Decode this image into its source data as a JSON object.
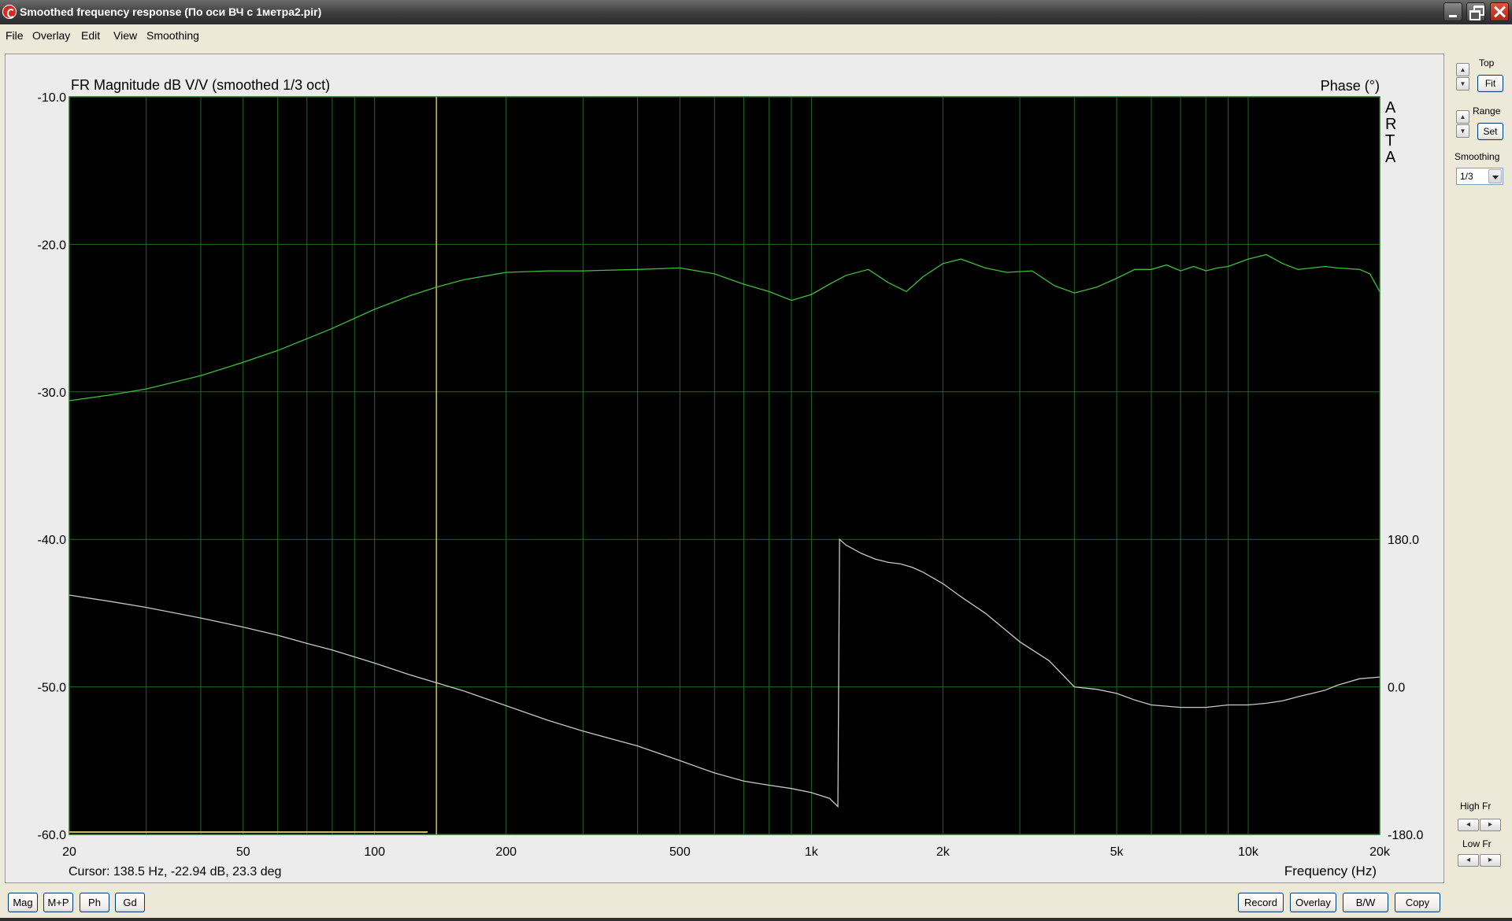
{
  "window": {
    "title": "Smoothed frequency response (По оси ВЧ с 1метра2.pir)"
  },
  "menu": [
    "File",
    "Overlay",
    "Edit",
    "View",
    "Smoothing"
  ],
  "sidebar": {
    "top_label": "Top",
    "fit_button": "Fit",
    "range_label": "Range",
    "set_button": "Set",
    "smoothing_label": "Smoothing",
    "smoothing_value": "1/3",
    "high_fr_label": "High Fr",
    "low_fr_label": "Low Fr"
  },
  "bottom_buttons": {
    "mag": "Mag",
    "mp": "M+P",
    "ph": "Ph",
    "gd": "Gd",
    "record": "Record",
    "overlay": "Overlay",
    "bw": "B/W",
    "copy": "Copy"
  },
  "plot": {
    "background": "#000000",
    "grid_color": "#1f6b1f",
    "magnitude_color": "#3cbf3c",
    "phase_color": "#c8c8c8",
    "cursor_color": "#c8c060"
  },
  "chart_data": {
    "type": "line",
    "title": "FR Magnitude dB V/V (smoothed 1/3 oct)",
    "right_title": "Phase (°)",
    "watermark": "ARTA",
    "xlabel": "Frequency (Hz)",
    "x_scale": "log",
    "xlim": [
      20,
      20000
    ],
    "ylim": [
      -60,
      -10
    ],
    "y2lim": [
      -180,
      180
    ],
    "x_ticks": [
      20,
      50,
      100,
      200,
      500,
      1000,
      2000,
      5000,
      10000,
      20000
    ],
    "x_tick_labels": [
      "20",
      "50",
      "100",
      "200",
      "500",
      "1k",
      "2k",
      "5k",
      "10k",
      "20k"
    ],
    "y_ticks": [
      -10,
      -20,
      -30,
      -40,
      -50,
      -60
    ],
    "y_tick_labels": [
      "-10.0",
      "-20.0",
      "-30.0",
      "-40.0",
      "-50.0",
      "-60.0"
    ],
    "y2_ticks": [
      180,
      0,
      -180
    ],
    "y2_tick_labels": [
      "180.0",
      "0.0",
      "-180.0"
    ],
    "grid": true,
    "cursor": {
      "freq": 138.5,
      "text": "Cursor: 138.5 Hz, -22.94 dB, 23.3 deg"
    },
    "series": [
      {
        "axis": "left",
        "x": [
          20,
          25,
          30,
          40,
          50,
          60,
          70,
          80,
          100,
          120,
          138.5,
          160,
          200,
          250,
          300,
          400,
          500,
          600,
          700,
          800,
          900,
          1000,
          1100,
          1200,
          1350,
          1500,
          1650,
          1800,
          2000,
          2200,
          2500,
          2800,
          3200,
          3600,
          4000,
          4500,
          5000,
          5500,
          6000,
          6500,
          7000,
          7500,
          8000,
          8500,
          9000,
          10000,
          11000,
          12000,
          13000,
          14000,
          15000,
          16000,
          18000,
          19000,
          20000
        ],
        "values": [
          -30.6,
          -30.2,
          -29.8,
          -28.9,
          -28.0,
          -27.2,
          -26.4,
          -25.7,
          -24.4,
          -23.5,
          -22.9,
          -22.4,
          -21.9,
          -21.8,
          -21.8,
          -21.7,
          -21.6,
          -22.0,
          -22.7,
          -23.2,
          -23.8,
          -23.4,
          -22.7,
          -22.1,
          -21.7,
          -22.6,
          -23.2,
          -22.2,
          -21.3,
          -21.0,
          -21.6,
          -21.9,
          -21.8,
          -22.8,
          -23.3,
          -22.9,
          -22.3,
          -21.7,
          -21.7,
          -21.4,
          -21.8,
          -21.5,
          -21.8,
          -21.6,
          -21.5,
          -21.0,
          -20.7,
          -21.3,
          -21.7,
          -21.6,
          -21.5,
          -21.6,
          -21.7,
          -22.0,
          -23.2
        ]
      },
      {
        "axis": "right",
        "x": [
          20,
          25,
          30,
          40,
          50,
          60,
          70,
          80,
          100,
          120,
          138.5,
          160,
          200,
          250,
          300,
          400,
          500,
          600,
          700,
          800,
          900,
          1000,
          1100,
          1150,
          1160,
          1200,
          1300,
          1400,
          1500,
          1600,
          1700,
          1800,
          2000,
          2200,
          2500,
          3000,
          3500,
          4000,
          4500,
          5000,
          5500,
          6000,
          7000,
          8000,
          9000,
          10000,
          11000,
          12000,
          13000,
          14000,
          15000,
          16000,
          18000,
          20000
        ],
        "values": [
          112,
          104,
          97,
          84,
          73,
          63,
          53,
          45,
          29,
          15,
          5,
          -5,
          -23,
          -41,
          -54,
          -72,
          -90,
          -105,
          -115,
          -120,
          -124,
          -129,
          -136,
          -146,
          180,
          173,
          163,
          156,
          152,
          150,
          146,
          140,
          126,
          110,
          90,
          55,
          32,
          0,
          -3,
          -8,
          -16,
          -22,
          -25,
          -25,
          -22,
          -22,
          -20,
          -17,
          -12,
          -8,
          -4,
          2,
          10,
          12
        ]
      }
    ]
  },
  "cursor_readout": "Cursor: 138.5 Hz, -22.94 dB, 23.3 deg",
  "x_axis_title": "Frequency (Hz)"
}
